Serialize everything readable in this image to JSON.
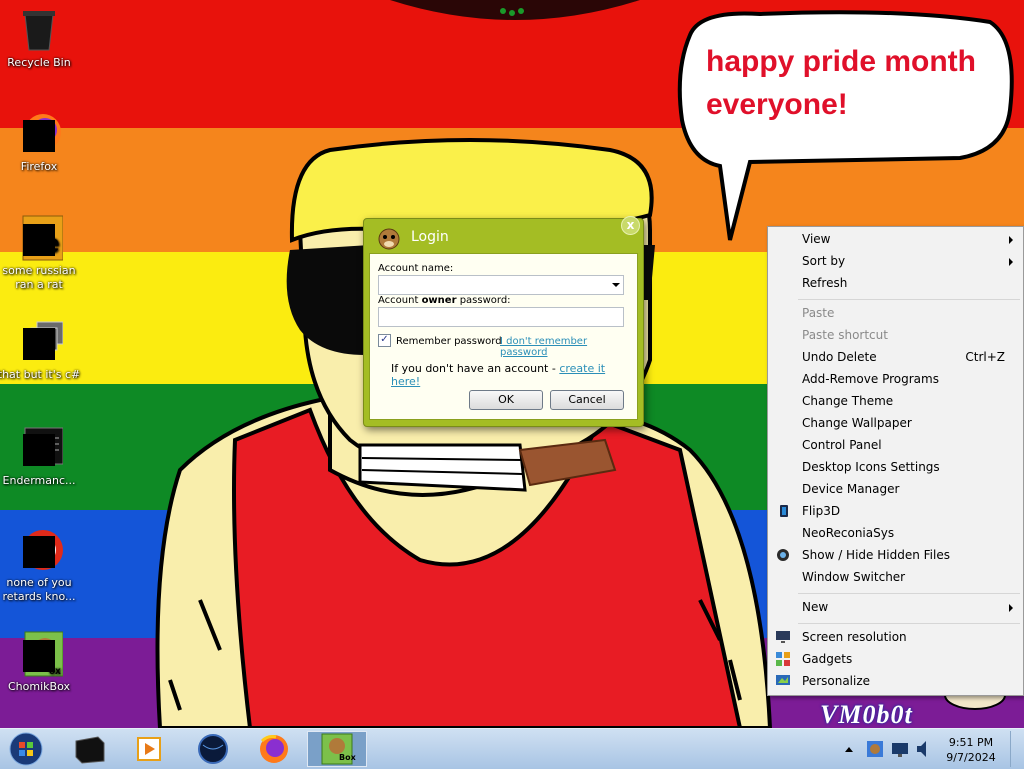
{
  "wallpaper": {
    "bubble_line1": "happy pride month",
    "bubble_line2": "everyone!",
    "watermark": "VM0b0t",
    "stripe_colors": [
      "#e8120c",
      "#f5851c",
      "#fbec10",
      "#0e8a25",
      "#1455d8",
      "#7c1c96"
    ]
  },
  "desktop_icons": [
    {
      "label": "Recycle Bin",
      "icon": "recycle-bin-icon"
    },
    {
      "label": "Firefox",
      "icon": "firefox-icon"
    },
    {
      "label": "some russian ran a rat",
      "icon": "rat-app-icon"
    },
    {
      "label": "that but it's c#",
      "icon": "windows-stack-icon"
    },
    {
      "label": "Endermanc...",
      "icon": "console-window-icon"
    },
    {
      "label": "none of you retards kno...",
      "icon": "red-circle-app-icon"
    },
    {
      "label": "ChomikBox",
      "icon": "chomikbox-icon"
    }
  ],
  "login": {
    "title": "Login",
    "account_label": "Account name:",
    "account_value": "",
    "password_label_pre": "Account ",
    "password_label_bold": "owner",
    "password_label_post": " password:",
    "password_value": "",
    "remember_label": "Remember password",
    "remember_checked": "✓",
    "forgot_link": "I don't remember password",
    "no_account_text": "If you don't have an account - ",
    "create_link": "create it here!",
    "ok_label": "OK",
    "cancel_label": "Cancel",
    "close_label": "x"
  },
  "context_menu": {
    "view": "View",
    "sort_by": "Sort by",
    "refresh": "Refresh",
    "paste": "Paste",
    "paste_shortcut": "Paste shortcut",
    "undo_delete": "Undo Delete",
    "undo_shortcut": "Ctrl+Z",
    "add_remove": "Add-Remove Programs",
    "change_theme": "Change Theme",
    "change_wallpaper": "Change Wallpaper",
    "control_panel": "Control Panel",
    "desktop_icons_settings": "Desktop Icons Settings",
    "device_manager": "Device Manager",
    "flip3d": "Flip3D",
    "neoreconiasys": "NeoReconiaSys",
    "show_hide": "Show / Hide Hidden Files",
    "window_switcher": "Window Switcher",
    "new": "New",
    "screen_resolution": "Screen resolution",
    "gadgets": "Gadgets",
    "personalize": "Personalize"
  },
  "taskbar": {
    "time": "9:51 PM",
    "date": "9/7/2024",
    "chomikbox_label": "Box"
  }
}
